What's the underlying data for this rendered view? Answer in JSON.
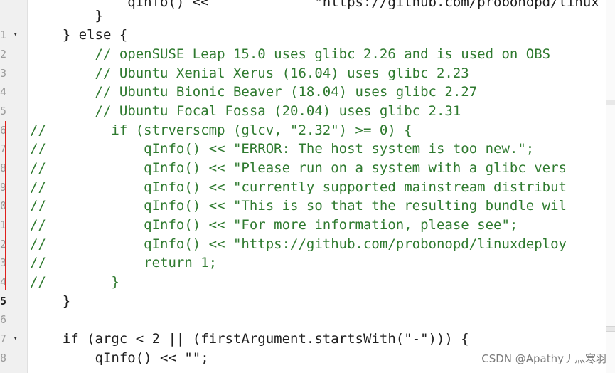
{
  "gutter": {
    "line_numbers": [
      "",
      "1",
      "2",
      "3",
      "4",
      "5",
      "6",
      "7",
      "8",
      "9",
      "0",
      "1",
      "2",
      "3",
      "4",
      "5",
      "6",
      "7",
      "8"
    ]
  },
  "code_lines": [
    "            qInfo() <<             \"https://github.com/probonopd/linux",
    "        }",
    "    } else {",
    "        // openSUSE Leap 15.0 uses glibc 2.26 and is used on OBS",
    "        // Ubuntu Xenial Xerus (16.04) uses glibc 2.23",
    "        // Ubuntu Bionic Beaver (18.04) uses glibc 2.27",
    "        // Ubuntu Focal Fossa (20.04) uses glibc 2.31",
    "//        if (strverscmp (glcv, \"2.32\") >= 0) {",
    "//            qInfo() << \"ERROR: The host system is too new.\";",
    "//            qInfo() << \"Please run on a system with a glibc vers",
    "//            qInfo() << \"currently supported mainstream distribut",
    "//            qInfo() << \"This is so that the resulting bundle wil",
    "//            qInfo() << \"For more information, please see\";",
    "//            qInfo() << \"https://github.com/probonopd/linuxdeploy",
    "//            return 1;",
    "//        }",
    "    }",
    "",
    "    if (argc < 2 || (firstArgument.startsWith(\"-\"))) {",
    "        qInfo() << \"\";"
  ],
  "watermark": "CSDN @Apathy丿灬寒羽"
}
